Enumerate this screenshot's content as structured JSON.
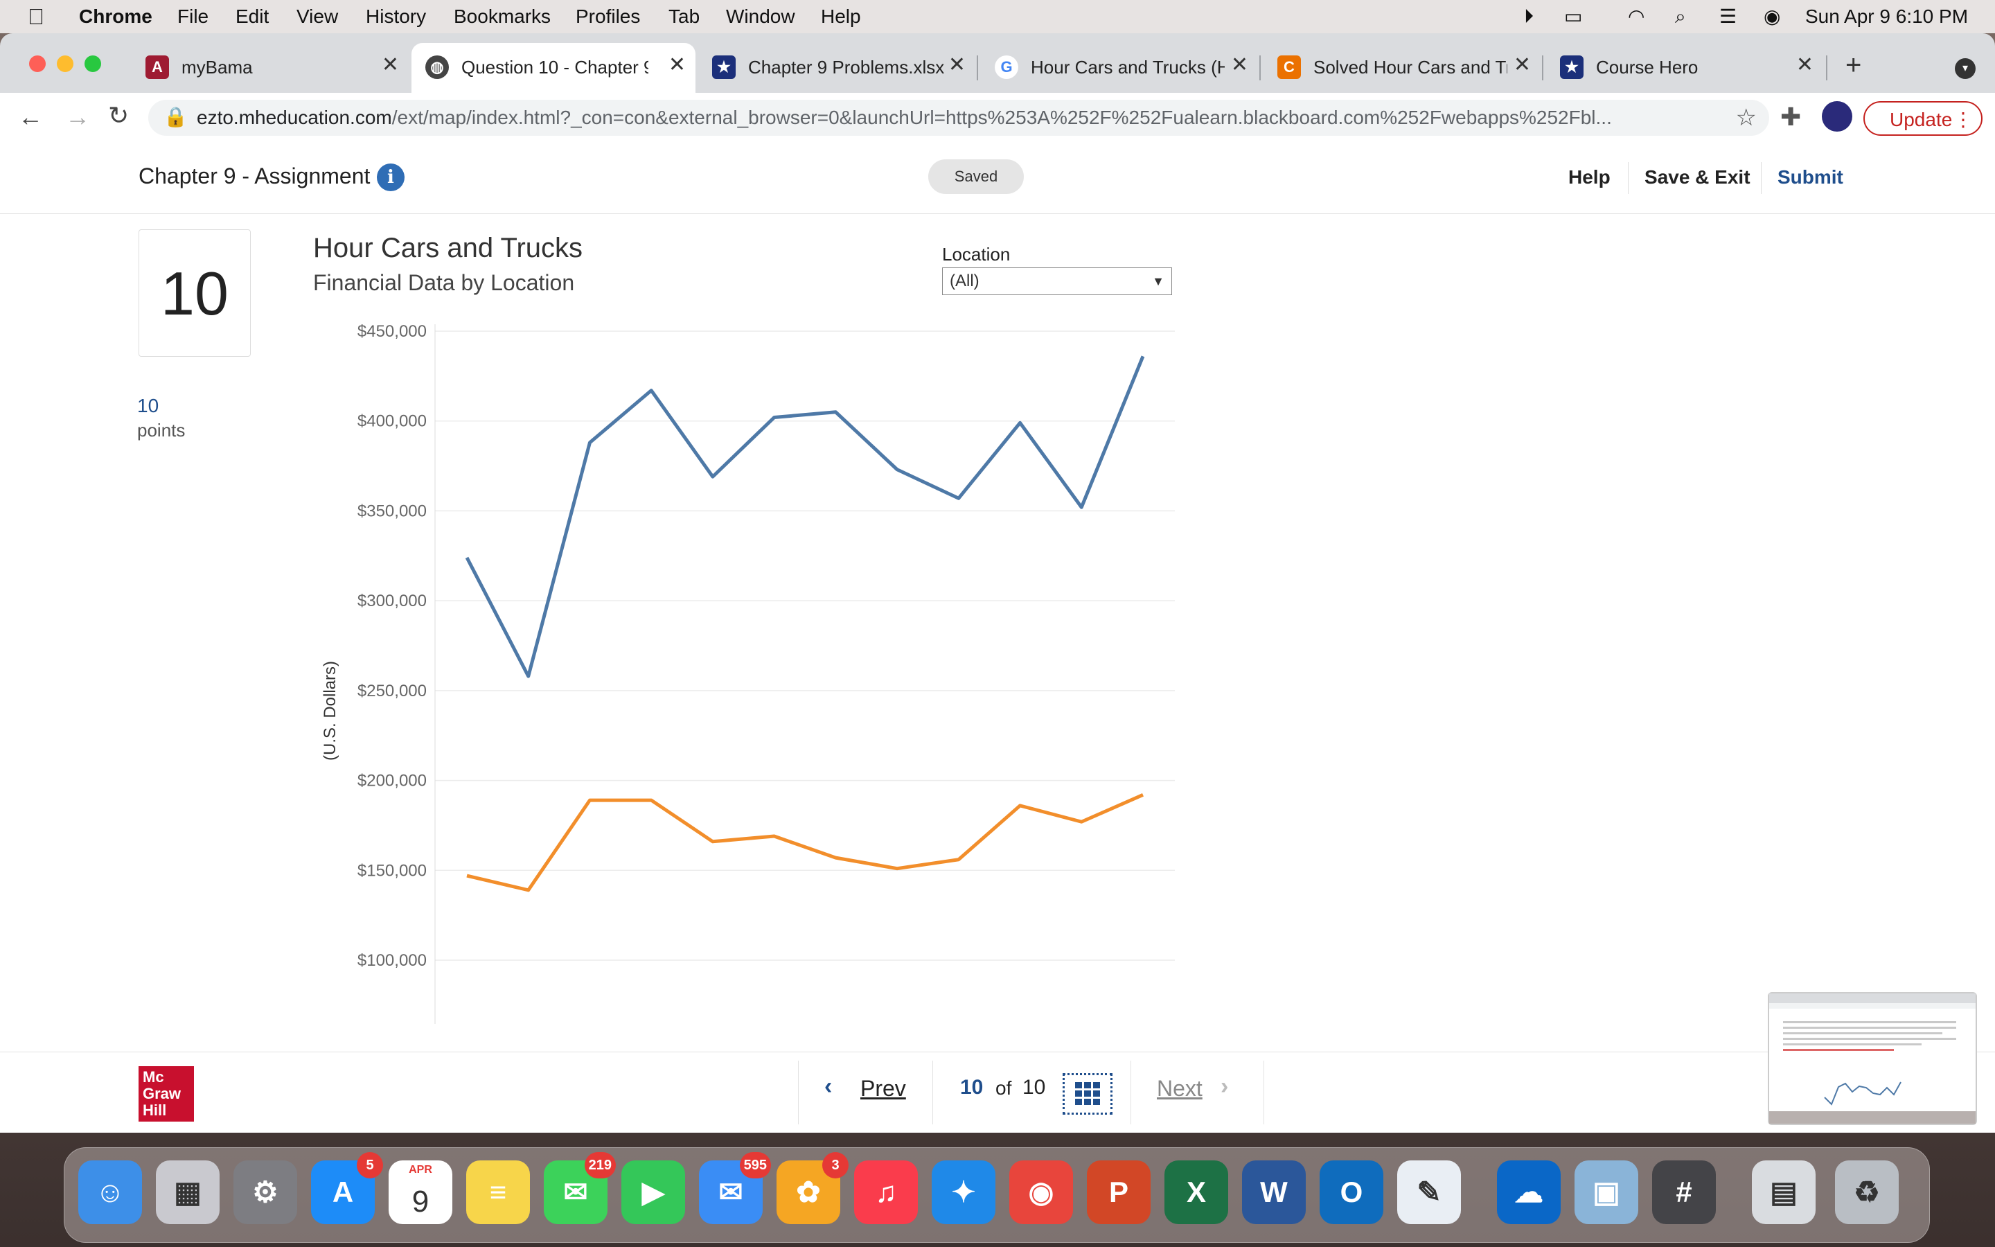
{
  "menubar": {
    "app": "Chrome",
    "items": [
      "File",
      "Edit",
      "View",
      "History",
      "Bookmarks",
      "Profiles",
      "Tab",
      "Window",
      "Help"
    ],
    "datetime": "Sun Apr 9  6:10 PM"
  },
  "tabs": [
    {
      "title": "myBama",
      "icon": "alabama-icon"
    },
    {
      "title": "Question 10 - Chapter 9",
      "icon": "globe-icon"
    },
    {
      "title": "Chapter 9 Problems.xlsx",
      "icon": "star-icon"
    },
    {
      "title": "Hour Cars and Trucks (H",
      "icon": "google-icon"
    },
    {
      "title": "Solved Hour Cars and Tr",
      "icon": "chegg-icon"
    },
    {
      "title": "Course Hero",
      "icon": "star-icon"
    }
  ],
  "address": {
    "host": "ezto.mheducation.com",
    "path": "/ext/map/index.html?_con=con&external_browser=0&launchUrl=https%253A%252F%252Fualearn.blackboard.com%252Fwebapps%252Fbl...",
    "update_label": "Update"
  },
  "assignment": {
    "title": "Chapter 9 - Assignment",
    "saved_label": "Saved",
    "help_label": "Help",
    "save_exit_label": "Save & Exit",
    "submit_label": "Submit"
  },
  "question": {
    "number": "10",
    "points_value": "10",
    "points_label": "points"
  },
  "location_filter": {
    "label": "Location",
    "selected": "(All)"
  },
  "chart_data": {
    "type": "line",
    "title": "Hour Cars and Trucks",
    "subtitle": "Financial Data by Location",
    "ylabel": "(U.S. Dollars)",
    "ylim": [
      100000,
      450000
    ],
    "yticks": [
      "$450,000",
      "$400,000",
      "$350,000",
      "$300,000",
      "$250,000",
      "$200,000",
      "$150,000",
      "$100,000"
    ],
    "grid": true,
    "series": [
      {
        "color": "#4e79a7",
        "values": [
          324000,
          258000,
          388000,
          417000,
          369000,
          402000,
          405000,
          373000,
          357000,
          399000,
          352000,
          436000
        ]
      },
      {
        "color": "#f28e2b",
        "values": [
          147000,
          139000,
          189000,
          189000,
          166000,
          169000,
          157000,
          151000,
          156000,
          186000,
          177000,
          192000
        ]
      }
    ]
  },
  "pager": {
    "prev_label": "Prev",
    "next_label": "Next",
    "current": "10",
    "of_label": "of",
    "total": "10"
  },
  "logo": {
    "line1": "Mc",
    "line2": "Graw",
    "line3": "Hill"
  },
  "dock": [
    {
      "name": "finder",
      "color": "#3d8fe8",
      "glyph": "☺"
    },
    {
      "name": "launchpad",
      "color": "#c9c9cf",
      "glyph": "▦"
    },
    {
      "name": "system-preferences",
      "color": "#7d7d82",
      "glyph": "⚙"
    },
    {
      "name": "app-store",
      "color": "#1d8cf8",
      "glyph": "A",
      "badge": "5"
    },
    {
      "name": "calendar",
      "color": "#ffffff",
      "glyph": "9"
    },
    {
      "name": "notes",
      "color": "#f7d54a",
      "glyph": "≡"
    },
    {
      "name": "messages",
      "color": "#3cd25a",
      "glyph": "✉",
      "badge": "219"
    },
    {
      "name": "facetime",
      "color": "#34c759",
      "glyph": "▶"
    },
    {
      "name": "mail",
      "color": "#3a8df5",
      "glyph": "✉",
      "badge": "595"
    },
    {
      "name": "photos",
      "color": "#f5a623",
      "glyph": "✿",
      "badge": "3"
    },
    {
      "name": "music",
      "color": "#fa3c4c",
      "glyph": "♫"
    },
    {
      "name": "safari",
      "color": "#1f89e8",
      "glyph": "✦"
    },
    {
      "name": "chrome",
      "color": "#e8453c",
      "glyph": "◉"
    },
    {
      "name": "powerpoint",
      "color": "#d24726",
      "glyph": "P"
    },
    {
      "name": "excel",
      "color": "#1d7145",
      "glyph": "X"
    },
    {
      "name": "word",
      "color": "#2b579a",
      "glyph": "W"
    },
    {
      "name": "outlook",
      "color": "#0f6cbd",
      "glyph": "O"
    },
    {
      "name": "textedit",
      "color": "#e9eef4",
      "glyph": "✎"
    },
    {
      "name": "onedrive",
      "color": "#0a67c7",
      "glyph": "☁"
    },
    {
      "name": "preview",
      "color": "#8ab4d8",
      "glyph": "▣"
    },
    {
      "name": "calculator",
      "color": "#444448",
      "glyph": "#"
    },
    {
      "name": "documents",
      "color": "#d9dce0",
      "glyph": "▤"
    },
    {
      "name": "trash",
      "color": "#b9bec4",
      "glyph": "♻"
    }
  ],
  "dock_calendar_month": "APR"
}
